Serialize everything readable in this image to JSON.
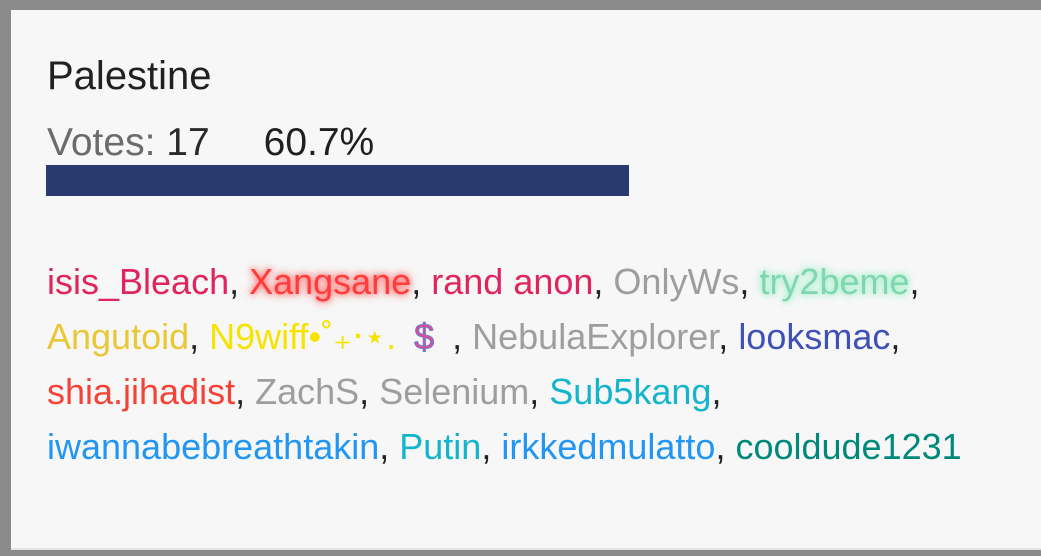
{
  "poll_option": {
    "title": "Palestine",
    "votes_label": "Votes:",
    "votes_count": "17",
    "percent_text": "60.7%",
    "percent_value": 0.607,
    "bar_color": "#283a70"
  },
  "voters": [
    {
      "name": "isis_Bleach",
      "color": "#e0245e"
    },
    {
      "name": "Xangsane",
      "color": "#ff3b3b",
      "glow": "#ff6b6b"
    },
    {
      "name": "rand anon",
      "color": "#e0245e"
    },
    {
      "name": "OnlyWs",
      "color": "#9e9e9e"
    },
    {
      "name": "try2beme",
      "color": "#7fd6b0",
      "glow": "#9ff0c8"
    },
    {
      "name": "Angutoid",
      "color": "#e9c736"
    },
    {
      "name": "N9wiff•˚₊‧⋆.",
      "color": "#f7e300",
      "icon": "dollar-icon",
      "icon_char": "$"
    },
    {
      "name": "NebulaExplorer",
      "color": "#9e9e9e"
    },
    {
      "name": "looksmac",
      "color": "#3f51b5"
    },
    {
      "name": "shia.jihadist",
      "color": "#f44336"
    },
    {
      "name": "ZachS",
      "color": "#9e9e9e"
    },
    {
      "name": "Selenium",
      "color": "#9e9e9e"
    },
    {
      "name": "Sub5kang",
      "color": "#12b5cb"
    },
    {
      "name": "iwannabebreathtakin",
      "color": "#2196f3"
    },
    {
      "name": "Putin",
      "color": "#12b5cb"
    },
    {
      "name": "irkkedmulatto",
      "color": "#2196f3"
    },
    {
      "name": "cooldude1231",
      "color": "#00897b"
    }
  ]
}
